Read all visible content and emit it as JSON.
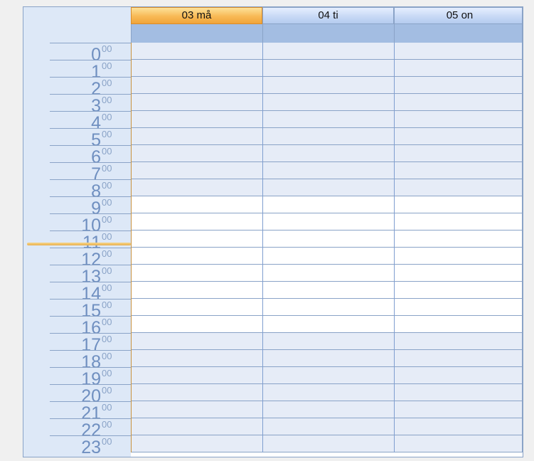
{
  "days": [
    {
      "label": "03 må",
      "today": true
    },
    {
      "label": "04 ti",
      "today": false
    },
    {
      "label": "05 on",
      "today": false
    }
  ],
  "hours": [
    "0",
    "1",
    "2",
    "3",
    "4",
    "5",
    "6",
    "7",
    "8",
    "9",
    "10",
    "11",
    "12",
    "13",
    "14",
    "15",
    "16",
    "17",
    "18",
    "19",
    "20",
    "21",
    "22",
    "23"
  ],
  "minutes_label": "00",
  "work_hours": {
    "start": 9,
    "end": 17
  },
  "colors": {
    "today_header": "#f8b955",
    "header": "#c8d9f5",
    "allday_strip": "#a3bde2",
    "offhours_slot": "#e6ecf7",
    "workhours_slot": "#ffffff",
    "grid_line": "#8aa3c7",
    "now_indicator": "#e8b04f"
  }
}
